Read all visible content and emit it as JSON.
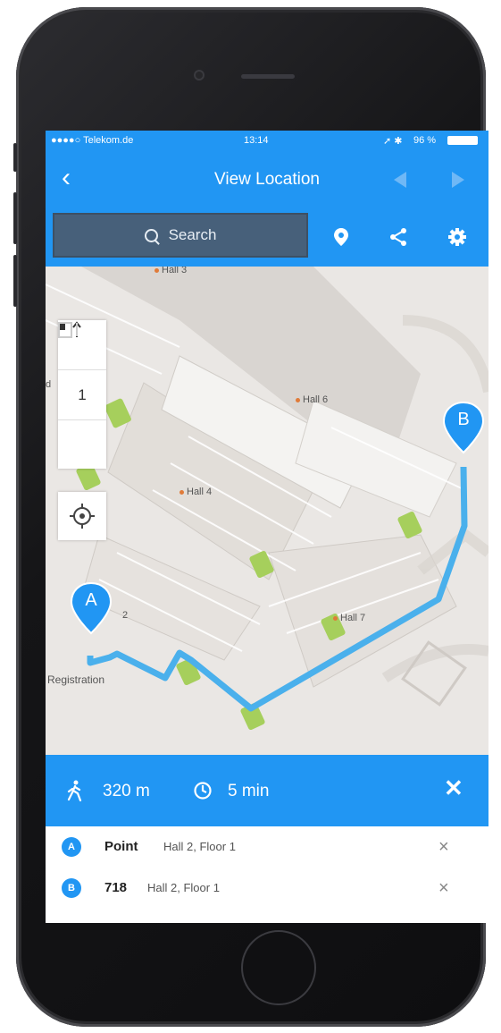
{
  "status": {
    "carrier": "●●●●○ Telekom.de",
    "time": "13:14",
    "battery": "96 %"
  },
  "nav": {
    "back": "‹",
    "title": "View Location"
  },
  "toolbar": {
    "search_label": "Search"
  },
  "map": {
    "labels": {
      "hall3": "Hall 3",
      "hall6": "Hall 6",
      "hall4": "Hall 4",
      "hall7": "Hall 7",
      "registration": "Registration",
      "d": "d",
      "two": "2"
    },
    "floor": "1",
    "pin_a": "A",
    "pin_b": "B"
  },
  "route": {
    "distance": "320 m",
    "time": "5 min",
    "close": "✕"
  },
  "waypoints": [
    {
      "badge": "A",
      "name": "Point",
      "location": "Hall 2, Floor 1",
      "remove": "×"
    },
    {
      "badge": "B",
      "name": "718",
      "location": "Hall 2, Floor 1",
      "remove": "×"
    }
  ],
  "colors": {
    "accent": "#2196f3",
    "route": "#4ab0ec",
    "search_bg": "#47607a"
  }
}
